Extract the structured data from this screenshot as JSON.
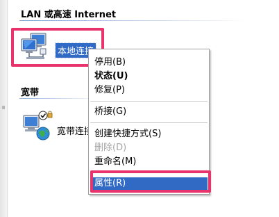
{
  "groups": {
    "lan": {
      "header": "LAN 或高速 Internet",
      "items": [
        {
          "label": "本地连接",
          "icon": "lan-network-icon",
          "selected": true
        }
      ]
    },
    "broadband": {
      "header": "宽带",
      "items": [
        {
          "label": "宽带连接",
          "icon": "broadband-connection-icon",
          "selected": false
        }
      ]
    }
  },
  "context_menu": {
    "items": [
      {
        "label": "停用(B)",
        "style": "normal"
      },
      {
        "label": "状态(U)",
        "style": "bold"
      },
      {
        "label": "修复(P)",
        "style": "normal"
      },
      {
        "label": "桥接(G)",
        "style": "normal"
      },
      {
        "label": "创建快捷方式(S)",
        "style": "normal"
      },
      {
        "label": "删除(D)",
        "style": "disabled"
      },
      {
        "label": "重命名(M)",
        "style": "normal"
      },
      {
        "label": "属性(R)",
        "style": "selected"
      }
    ]
  },
  "colors": {
    "selection": "#316ac5",
    "annotation_box": "#e8336d",
    "disabled_text": "#a6a6a6"
  }
}
